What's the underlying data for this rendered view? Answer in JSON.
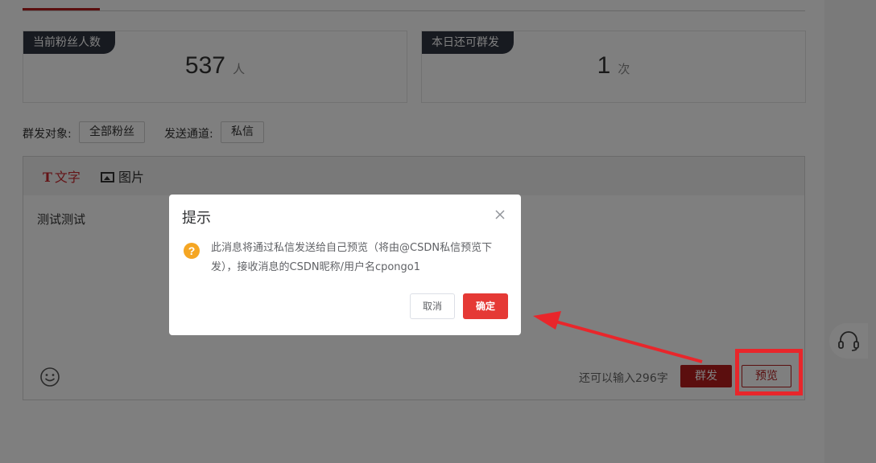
{
  "stats": {
    "fans": {
      "label": "当前粉丝人数",
      "value": "537",
      "unit": "人"
    },
    "quota": {
      "label": "本日还可群发",
      "value": "1",
      "unit": "次"
    }
  },
  "target": {
    "label": "群发对象:",
    "value": "全部粉丝"
  },
  "channel": {
    "label": "发送通道:",
    "value": "私信"
  },
  "editor": {
    "tool_text_icon": "T",
    "tool_text": "文字",
    "tool_image": "图片",
    "content": "测试测试",
    "remaining": "还可以输入296字",
    "send_label": "群发",
    "preview_label": "预览"
  },
  "dialog": {
    "title": "提示",
    "icon_glyph": "?",
    "message": "此消息将通过私信发送给自己预览（将由@CSDN私信预览下发），接收消息的CSDN昵称/用户名cpongo1",
    "cancel_label": "取消",
    "confirm_label": "确定"
  },
  "colors": {
    "accent": "#b41f1f",
    "confirm": "#e53935",
    "annotation": "#e8262b",
    "warning": "#f5a623",
    "tag_bg": "#2f3440"
  },
  "icons": [
    "text-format-icon",
    "image-icon",
    "emoji-icon",
    "headset-icon",
    "close-icon",
    "question-icon"
  ]
}
